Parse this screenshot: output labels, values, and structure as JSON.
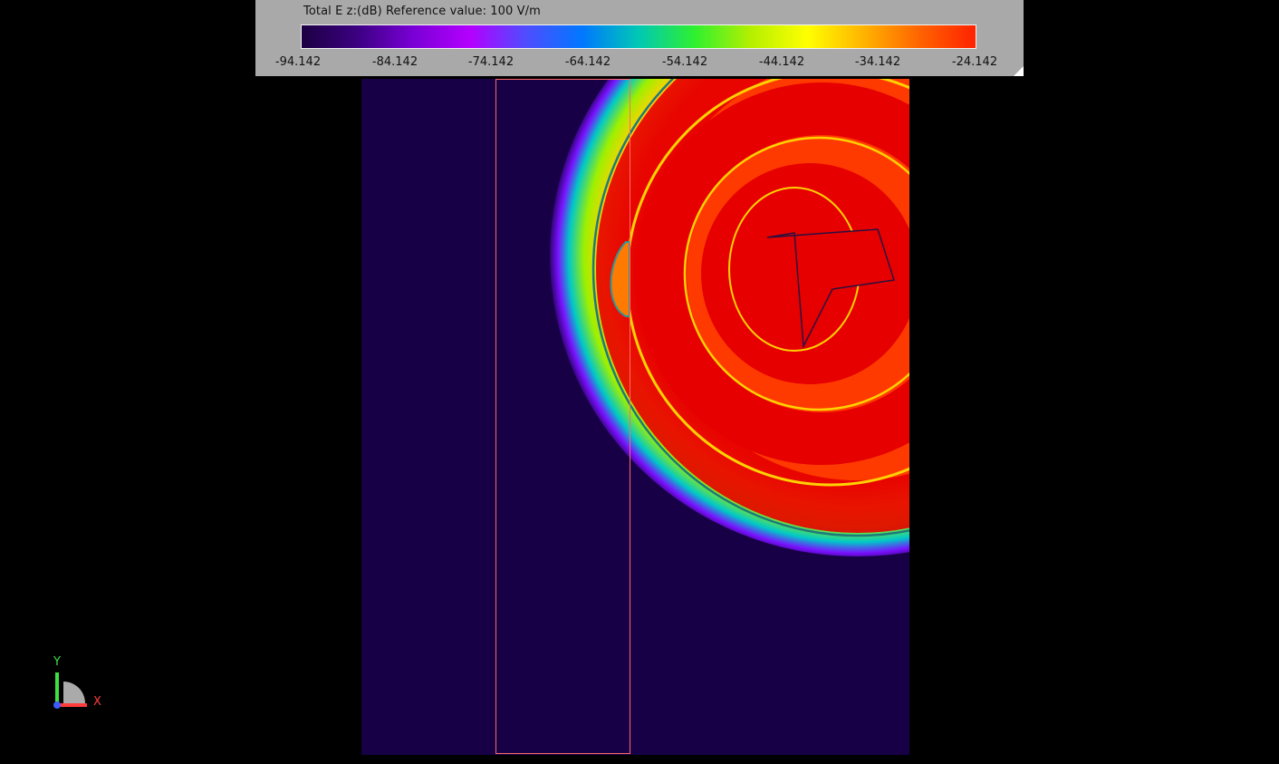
{
  "legend": {
    "title": "Total E z:(dB) Reference value: 100 V/m",
    "ticks": [
      "-94.142",
      "-84.142",
      "-74.142",
      "-64.142",
      "-54.142",
      "-44.142",
      "-34.142",
      "-24.142"
    ],
    "gradient_colors": [
      "#1c0042",
      "#3c0082",
      "#7a00d6",
      "#b400ff",
      "#4f4dff",
      "#0078ff",
      "#00c8b4",
      "#2ff02f",
      "#b4f000",
      "#ffff00",
      "#ffb400",
      "#ff6400",
      "#ff2200"
    ]
  },
  "field_plot": {
    "background_color": "#170046",
    "peak_color": "#e60000",
    "overlay_color": "#ff6a6a"
  },
  "axes_triad": {
    "y_label": "Y",
    "x_label": "X",
    "y_color": "#3fe03f",
    "x_color": "#ff3b3b",
    "z_color": "#3b5bff"
  }
}
